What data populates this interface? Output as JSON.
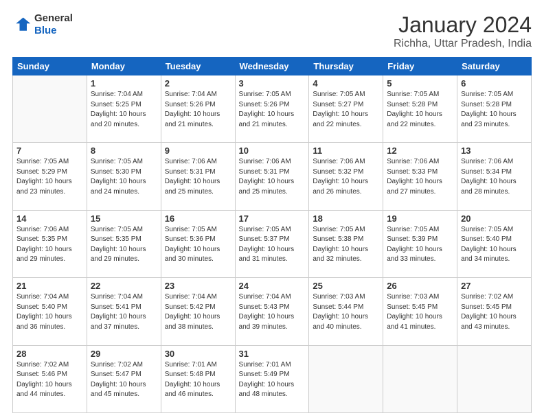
{
  "header": {
    "logo": "General Blue",
    "logo_line1": "General",
    "logo_line2": "Blue",
    "title": "January 2024",
    "subtitle": "Richha, Uttar Pradesh, India"
  },
  "weekdays": [
    "Sunday",
    "Monday",
    "Tuesday",
    "Wednesday",
    "Thursday",
    "Friday",
    "Saturday"
  ],
  "weeks": [
    [
      {
        "day": "",
        "info": ""
      },
      {
        "day": "1",
        "info": "Sunrise: 7:04 AM\nSunset: 5:25 PM\nDaylight: 10 hours\nand 20 minutes."
      },
      {
        "day": "2",
        "info": "Sunrise: 7:04 AM\nSunset: 5:26 PM\nDaylight: 10 hours\nand 21 minutes."
      },
      {
        "day": "3",
        "info": "Sunrise: 7:05 AM\nSunset: 5:26 PM\nDaylight: 10 hours\nand 21 minutes."
      },
      {
        "day": "4",
        "info": "Sunrise: 7:05 AM\nSunset: 5:27 PM\nDaylight: 10 hours\nand 22 minutes."
      },
      {
        "day": "5",
        "info": "Sunrise: 7:05 AM\nSunset: 5:28 PM\nDaylight: 10 hours\nand 22 minutes."
      },
      {
        "day": "6",
        "info": "Sunrise: 7:05 AM\nSunset: 5:28 PM\nDaylight: 10 hours\nand 23 minutes."
      }
    ],
    [
      {
        "day": "7",
        "info": ""
      },
      {
        "day": "8",
        "info": "Sunrise: 7:05 AM\nSunset: 5:30 PM\nDaylight: 10 hours\nand 24 minutes."
      },
      {
        "day": "9",
        "info": "Sunrise: 7:06 AM\nSunset: 5:31 PM\nDaylight: 10 hours\nand 25 minutes."
      },
      {
        "day": "10",
        "info": "Sunrise: 7:06 AM\nSunset: 5:31 PM\nDaylight: 10 hours\nand 25 minutes."
      },
      {
        "day": "11",
        "info": "Sunrise: 7:06 AM\nSunset: 5:32 PM\nDaylight: 10 hours\nand 26 minutes."
      },
      {
        "day": "12",
        "info": "Sunrise: 7:06 AM\nSunset: 5:33 PM\nDaylight: 10 hours\nand 27 minutes."
      },
      {
        "day": "13",
        "info": "Sunrise: 7:06 AM\nSunset: 5:34 PM\nDaylight: 10 hours\nand 28 minutes."
      }
    ],
    [
      {
        "day": "14",
        "info": ""
      },
      {
        "day": "15",
        "info": "Sunrise: 7:05 AM\nSunset: 5:35 PM\nDaylight: 10 hours\nand 29 minutes."
      },
      {
        "day": "16",
        "info": "Sunrise: 7:05 AM\nSunset: 5:36 PM\nDaylight: 10 hours\nand 30 minutes."
      },
      {
        "day": "17",
        "info": "Sunrise: 7:05 AM\nSunset: 5:37 PM\nDaylight: 10 hours\nand 31 minutes."
      },
      {
        "day": "18",
        "info": "Sunrise: 7:05 AM\nSunset: 5:38 PM\nDaylight: 10 hours\nand 32 minutes."
      },
      {
        "day": "19",
        "info": "Sunrise: 7:05 AM\nSunset: 5:39 PM\nDaylight: 10 hours\nand 33 minutes."
      },
      {
        "day": "20",
        "info": "Sunrise: 7:05 AM\nSunset: 5:40 PM\nDaylight: 10 hours\nand 34 minutes."
      }
    ],
    [
      {
        "day": "21",
        "info": ""
      },
      {
        "day": "22",
        "info": "Sunrise: 7:04 AM\nSunset: 5:41 PM\nDaylight: 10 hours\nand 37 minutes."
      },
      {
        "day": "23",
        "info": "Sunrise: 7:04 AM\nSunset: 5:42 PM\nDaylight: 10 hours\nand 38 minutes."
      },
      {
        "day": "24",
        "info": "Sunrise: 7:04 AM\nSunset: 5:43 PM\nDaylight: 10 hours\nand 39 minutes."
      },
      {
        "day": "25",
        "info": "Sunrise: 7:03 AM\nSunset: 5:44 PM\nDaylight: 10 hours\nand 40 minutes."
      },
      {
        "day": "26",
        "info": "Sunrise: 7:03 AM\nSunset: 5:45 PM\nDaylight: 10 hours\nand 41 minutes."
      },
      {
        "day": "27",
        "info": "Sunrise: 7:02 AM\nSunset: 5:45 PM\nDaylight: 10 hours\nand 43 minutes."
      }
    ],
    [
      {
        "day": "28",
        "info": "Sunrise: 7:02 AM\nSunset: 5:46 PM\nDaylight: 10 hours\nand 44 minutes."
      },
      {
        "day": "29",
        "info": "Sunrise: 7:02 AM\nSunset: 5:47 PM\nDaylight: 10 hours\nand 45 minutes."
      },
      {
        "day": "30",
        "info": "Sunrise: 7:01 AM\nSunset: 5:48 PM\nDaylight: 10 hours\nand 46 minutes."
      },
      {
        "day": "31",
        "info": "Sunrise: 7:01 AM\nSunset: 5:49 PM\nDaylight: 10 hours\nand 48 minutes."
      },
      {
        "day": "",
        "info": ""
      },
      {
        "day": "",
        "info": ""
      },
      {
        "day": "",
        "info": ""
      }
    ]
  ],
  "week7_sunday_info": "Sunrise: 7:05 AM\nSunset: 5:29 PM\nDaylight: 10 hours\nand 23 minutes.",
  "week14_sunday_info": "Sunrise: 7:06 AM\nSunset: 5:35 PM\nDaylight: 10 hours\nand 29 minutes.",
  "week21_sunday_info": "Sunrise: 7:04 AM\nSunset: 5:40 PM\nDaylight: 10 hours\nand 36 minutes."
}
